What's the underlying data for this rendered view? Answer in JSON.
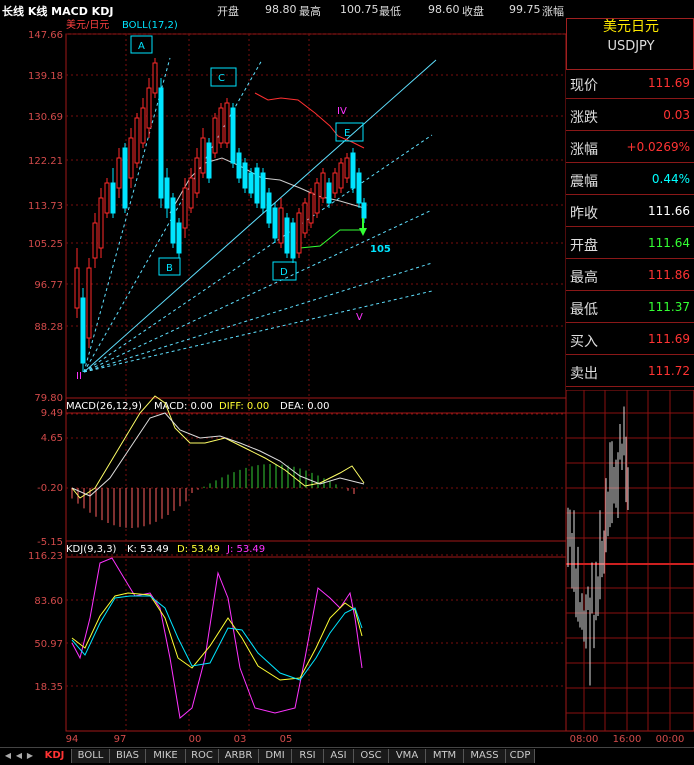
{
  "header": {
    "title": "长线 K线 MACD KDJ",
    "open_label": "开盘",
    "open_value": "98.80",
    "high_label": "最高",
    "high_value": "100.75",
    "low_label": "最低",
    "low_value": "98.60",
    "close_label": "收盘",
    "close_value": "99.75",
    "change_label": "涨幅"
  },
  "colors": {
    "up": "#ff2a2a",
    "down": "#00e5ff",
    "grid": "#8a1010",
    "yellow": "#ffff33",
    "magenta": "#ff33ff",
    "green": "#33cc33"
  },
  "main_panel": {
    "legend_name": "美元/日元",
    "legend_indicator": "BOLL(17,2)",
    "y_ticks": [
      "147.66",
      "139.18",
      "130.69",
      "122.21",
      "113.73",
      "105.25",
      "96.77",
      "88.28",
      "79.80"
    ],
    "annotations": {
      "A": "A",
      "B": "B",
      "C": "C",
      "D": "D",
      "E": "E",
      "II": "II",
      "IV": "IV",
      "V": "V",
      "target": "105"
    }
  },
  "macd_panel": {
    "legend_name": "MACD(26,12,9)",
    "legend_macd": "MACD: 0.00",
    "legend_diff": "DIFF: 0.00",
    "legend_dea": "DEA: 0.00",
    "y_ticks": [
      "9.49",
      "4.65",
      "-0.20",
      "-5.15"
    ]
  },
  "kdj_panel": {
    "legend_name": "KDJ(9,3,3)",
    "legend_k": "K: 53.49",
    "legend_d": "D: 53.49",
    "legend_j": "J: 53.49",
    "y_ticks": [
      "116.23",
      "83.60",
      "50.97",
      "18.35"
    ],
    "x_ticks": [
      "94",
      "97",
      "00",
      "03",
      "05"
    ]
  },
  "quote": {
    "title": "美元日元",
    "symbol": "USDJPY",
    "rows": [
      {
        "label": "现价",
        "value": "111.69",
        "color": "#ff3333"
      },
      {
        "label": "涨跌",
        "value": "0.03",
        "color": "#ff3333"
      },
      {
        "label": "涨幅",
        "value": "+0.0269%",
        "color": "#ff3333"
      },
      {
        "label": "震幅",
        "value": "0.44%",
        "color": "#00ffff"
      },
      {
        "label": "昨收",
        "value": "111.66",
        "color": "#ffffff"
      },
      {
        "label": "开盘",
        "value": "111.64",
        "color": "#33ff33"
      },
      {
        "label": "最高",
        "value": "111.86",
        "color": "#ff3333"
      },
      {
        "label": "最低",
        "value": "111.37",
        "color": "#33ff33"
      },
      {
        "label": "买入",
        "value": "111.69",
        "color": "#ff3333"
      },
      {
        "label": "卖出",
        "value": "111.72",
        "color": "#ff3333"
      }
    ]
  },
  "intraday": {
    "x_ticks": [
      "08:00",
      "16:00",
      "00:00"
    ]
  },
  "tabs": [
    "KDJ",
    "BOLL",
    "BIAS",
    "MIKE",
    "ROC",
    "ARBR",
    "DMI",
    "RSI",
    "ASI",
    "OSC",
    "VMA",
    "MTM",
    "MASS",
    "CDP"
  ],
  "active_tab": "KDJ"
}
